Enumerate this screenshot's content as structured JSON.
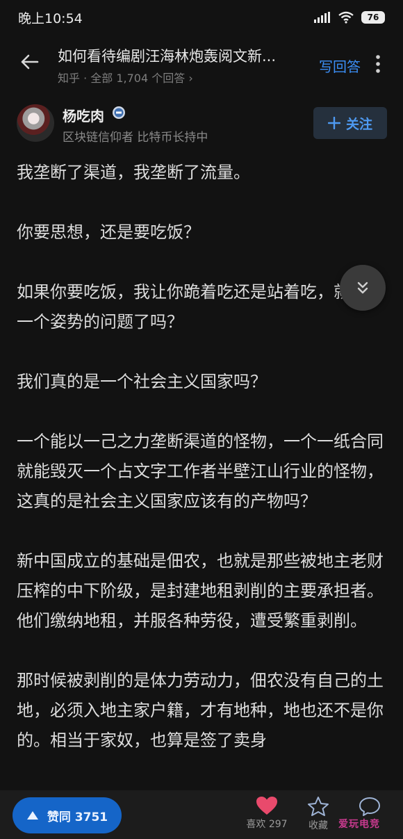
{
  "status_bar": {
    "time": "晚上10:54",
    "battery": "76"
  },
  "header": {
    "title": "如何看待编剧汪海林炮轰阅文新...",
    "subtitle": "知乎 · 全部 1,704 个回答 ›",
    "write_answer": "写回答"
  },
  "author": {
    "name": "杨吃肉",
    "bio": "区块链信仰者 比特币长持中",
    "follow": "关注"
  },
  "content": {
    "paragraphs": [
      "我垄断了渠道，我垄断了流量。",
      "你要思想，还是要吃饭？",
      "如果你要吃饭，我让你跪着吃还是站着吃，就只是一个姿势的问题了吗？",
      "我们真的是一个社会主义国家吗？",
      "一个能以一己之力垄断渠道的怪物，一个一纸合同就能毁灭一个占文字工作者半壁江山行业的怪物，这真的是社会主义国家应该有的产物吗？",
      "新中国成立的基础是佃农，也就是那些被地主老财压榨的中下阶级，是封建地租剥削的主要承担者。他们缴纳地租，并服各种劳役，遭受繁重剥削。",
      "那时候被剥削的是体力劳动力，佃农没有自己的土地，必须入地主家户籍，才有地种，地也还不是你的。相当于家奴，也算是签了卖身"
    ]
  },
  "bottom_bar": {
    "vote": "赞同 3751",
    "like": "喜欢 297",
    "collect": "收藏"
  },
  "watermark": "爱玩电竞",
  "colors": {
    "accent": "#3b8ef5",
    "vote_bg": "#1565c8",
    "heart": "#e94a6c"
  },
  "icons": [
    "back-arrow-icon",
    "more-icon",
    "badge-icon",
    "plus-icon",
    "double-chevron-down-icon",
    "triangle-up-icon",
    "heart-icon",
    "star-icon",
    "comment-icon"
  ]
}
